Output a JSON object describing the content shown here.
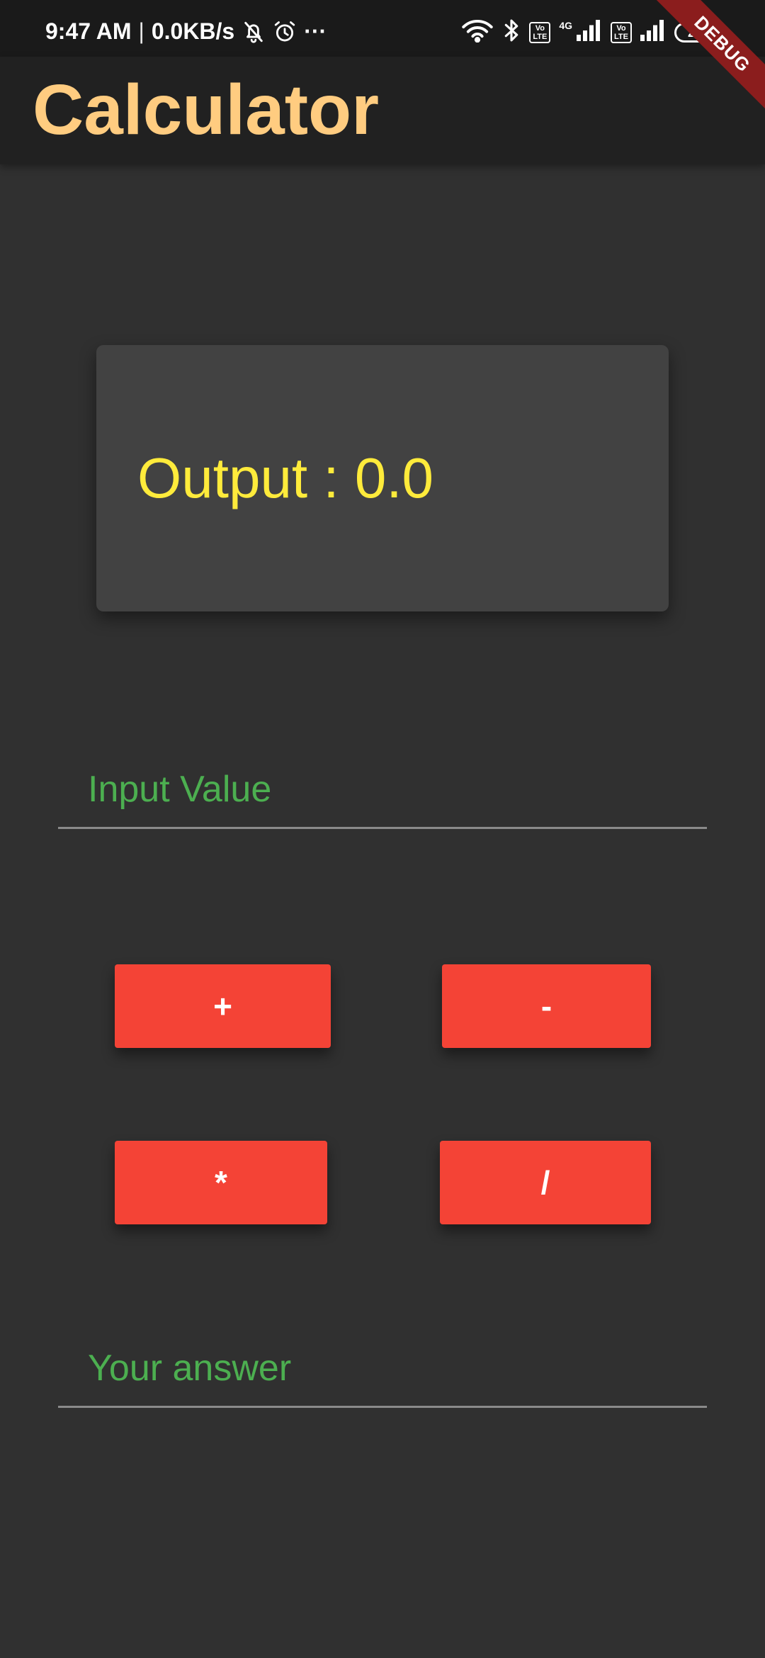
{
  "status_bar": {
    "time": "9:47 AM",
    "separator": "|",
    "net_speed": "0.0KB/s",
    "more": "···",
    "volte_1": "Vo\nLTE",
    "network_type": "4G",
    "volte_2": "Vo\nLTE",
    "battery_level": "28",
    "icons": [
      "bell-off-icon",
      "alarm-icon",
      "wifi-icon",
      "bluetooth-icon",
      "signal-icon",
      "signal-icon",
      "battery-icon"
    ]
  },
  "debug_banner": "DEBUG",
  "app_bar": {
    "title": "Calculator"
  },
  "output": {
    "text": "Output : 0.0"
  },
  "input_field": {
    "placeholder": "Input Value"
  },
  "buttons": {
    "add": "+",
    "subtract": "-",
    "multiply": "*",
    "divide": "/"
  },
  "answer_field": {
    "placeholder": "Your answer"
  },
  "colors": {
    "background": "#303030",
    "app_bar": "#212121",
    "title": "#ffcc80",
    "card": "#424242",
    "output_text": "#ffeb3b",
    "field_text": "#4caf50",
    "button": "#f44336"
  }
}
